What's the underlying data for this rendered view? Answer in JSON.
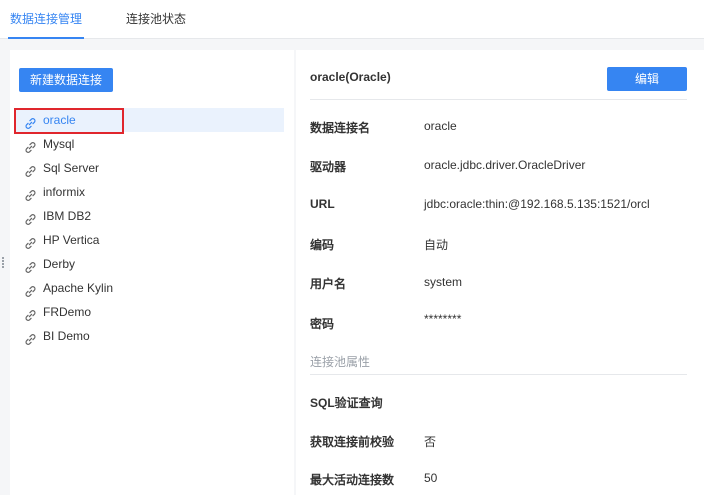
{
  "tabs": {
    "manage": "数据连接管理",
    "pool_status": "连接池状态"
  },
  "sidebar": {
    "new_button": "新建数据连接",
    "selected": "oracle",
    "connections": [
      "oracle",
      "Mysql",
      "Sql Server",
      "informix",
      "IBM DB2",
      "HP Vertica",
      "Derby",
      "Apache Kylin",
      "FRDemo",
      "BI Demo"
    ]
  },
  "detail": {
    "title": "oracle(Oracle)",
    "edit_button": "编辑",
    "fields": {
      "name_label": "数据连接名",
      "name_value": "oracle",
      "driver_label": "驱动器",
      "driver_value": "oracle.jdbc.driver.OracleDriver",
      "url_label": "URL",
      "url_value": "jdbc:oracle:thin:@192.168.5.135:1521/orcl",
      "encoding_label": "编码",
      "encoding_value": "自动",
      "user_label": "用户名",
      "user_value": "system",
      "password_label": "密码",
      "password_value": "********"
    },
    "pool_section": {
      "title": "连接池属性",
      "sql_check_label": "SQL验证查询",
      "validate_label": "获取连接前校验",
      "validate_value": "否",
      "max_active_label": "最大活动连接数",
      "max_active_value": "50"
    }
  },
  "icons": {
    "connection_icon": "link-icon",
    "drag_handle": "drag-handle-icon"
  },
  "colors": {
    "accent": "#3685f2",
    "selected_bg": "#eaf2fd",
    "highlight": "#e0262d"
  }
}
